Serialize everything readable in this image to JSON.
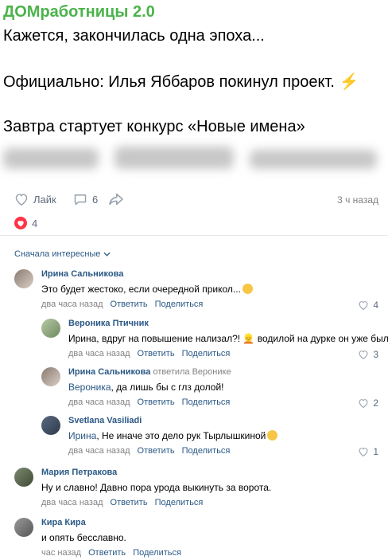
{
  "post": {
    "group_name": "ДОМработницы 2.0",
    "line1": "Кажется, закончилась одна эпоха...",
    "line2": "Официально: Илья Яббаров покинул проект.",
    "line2_emoji": "⚡",
    "line3": "Завтра стартует конкурс «Новые имена»",
    "like_label": "Лайк",
    "comments_count": "6",
    "time": "3 ч назад",
    "reactions_count": "4"
  },
  "comments_sort": "Сначала интересные",
  "comments": [
    {
      "name": "Ирина Сальникова",
      "text": "Это будет жестоко, если очередной прикол...",
      "time": "два часа назад",
      "reply": "Ответить",
      "share": "Поделиться",
      "likes": "4"
    },
    {
      "name": "Вероника Птичник",
      "text": "Ирина, вдруг на повышение нализал?! 👱 водилой на дурке он уже был",
      "time": "два часа назад",
      "reply": "Ответить",
      "share": "Поделиться",
      "likes": "3"
    },
    {
      "name": "Ирина Сальникова",
      "reply_to": "ответила Веронике",
      "mention": "Вероника",
      "text": ", да лишь бы с глз долой!",
      "time": "два часа назад",
      "reply": "Ответить",
      "share": "Поделиться",
      "likes": "2"
    },
    {
      "name": "Svetlana Vasiliadi",
      "mention": "Ирина",
      "text": ", Не иначе это дело рук Тырлышкиной",
      "time": "два часа назад",
      "reply": "Ответить",
      "share": "Поделиться",
      "likes": "1"
    },
    {
      "name": "Мария Петракова",
      "text": "Ну и славно! Давно пора урода выкинуть за ворота.",
      "time": "два часа назад",
      "reply": "Ответить",
      "share": "Поделиться",
      "likes": ""
    },
    {
      "name": "Кира Кира",
      "text": "и опять бесславно.",
      "time": "час назад",
      "reply": "Ответить",
      "share": "Поделиться",
      "likes": ""
    }
  ],
  "colors": {
    "accent": "#2a5885",
    "group": "#4bb34b",
    "heart": "#ff3347"
  }
}
